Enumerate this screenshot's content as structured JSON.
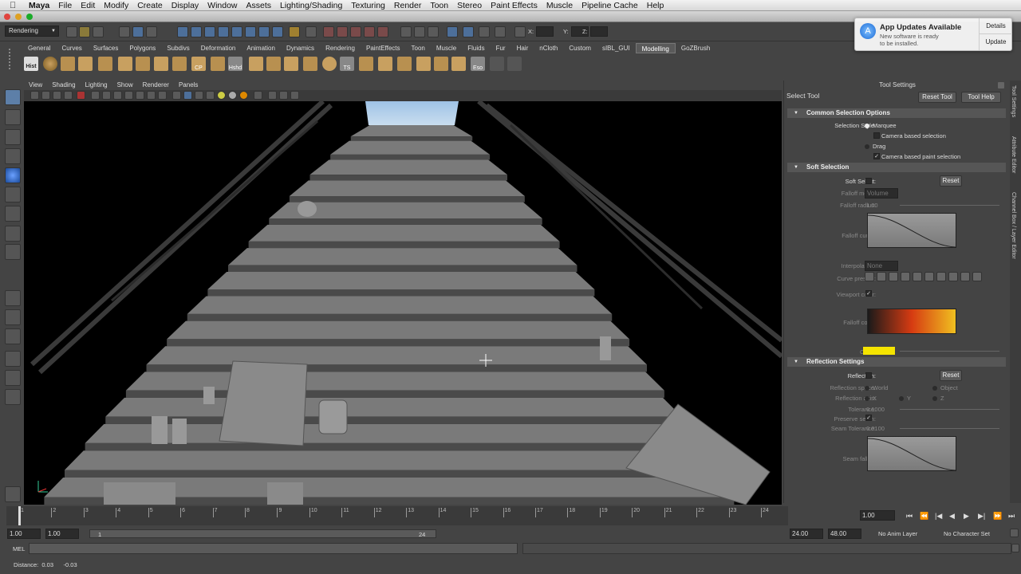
{
  "menubar": {
    "app": "Maya",
    "items": [
      "File",
      "Edit",
      "Modify",
      "Create",
      "Display",
      "Window",
      "Assets",
      "Lighting/Shading",
      "Texturing",
      "Render",
      "Toon",
      "Stereo",
      "Paint Effects",
      "Muscle",
      "Pipeline Cache",
      "Help"
    ]
  },
  "notification": {
    "title": "App Updates Available",
    "body": "New software is ready to be installed.",
    "details_label": "Details",
    "update_label": "Update"
  },
  "statusline": {
    "menuset": "Rendering",
    "x_label": "X:",
    "y_label": "Y:",
    "z_label": "Z:"
  },
  "shelf": {
    "tabs": [
      "General",
      "Curves",
      "Surfaces",
      "Polygons",
      "Subdivs",
      "Deformation",
      "Animation",
      "Dynamics",
      "Rendering",
      "PaintEffects",
      "Toon",
      "Muscle",
      "Fluids",
      "Fur",
      "Hair",
      "nCloth",
      "Custom",
      "sIBL_GUI",
      "Modelling",
      "GoZBrush"
    ],
    "active_tab": "Modelling",
    "icon_labels": {
      "hist": "Hist",
      "cp": "CP",
      "hshd": "Hshd",
      "ts": "TS",
      "eso": "Eso"
    }
  },
  "viewport_menu": [
    "View",
    "Shading",
    "Lighting",
    "Show",
    "Renderer",
    "Panels"
  ],
  "tool_settings": {
    "title": "Tool Settings",
    "tool_name": "Select Tool",
    "reset_tool": "Reset Tool",
    "tool_help": "Tool Help",
    "common": {
      "header": "Common Selection Options",
      "selection_style_label": "Selection Style:",
      "marquee": "Marquee",
      "camera_based_selection": "Camera based selection",
      "drag": "Drag",
      "camera_based_paint": "Camera based paint selection"
    },
    "soft": {
      "header": "Soft Selection",
      "soft_select_label": "Soft Select:",
      "reset": "Reset",
      "falloff_mode_label": "Falloff mode:",
      "falloff_mode_value": "Volume",
      "falloff_radius_label": "Falloff radius:",
      "falloff_radius_value": "1.00",
      "falloff_curve_label": "Falloff curve:",
      "interpolation_label": "Interpolation:",
      "interpolation_value": "None",
      "curve_presets_label": "Curve presets:",
      "viewport_color_label": "Viewport color:",
      "falloff_color_label": "Falloff color:",
      "color_label": "Color:"
    },
    "reflection": {
      "header": "Reflection Settings",
      "reflection_label": "Reflection:",
      "reset": "Reset",
      "space_label": "Reflection space:",
      "world": "World",
      "object": "Object",
      "axis_label": "Reflection axis:",
      "x": "X",
      "y": "Y",
      "z": "Z",
      "tolerance_label": "Tolerance:",
      "tolerance_value": "0.1000",
      "preserve_seam_label": "Preserve seam:",
      "seam_tolerance_label": "Seam Tolerance:",
      "seam_tolerance_value": "0.0100",
      "seam_falloff_label": "Seam falloff:"
    },
    "colors": {
      "falloff_start": "#1a1a1a",
      "falloff_mid": "#d63b12",
      "falloff_end": "#f0c020",
      "color_swatch": "#f5e400"
    }
  },
  "side_tabs": [
    "Tool Settings",
    "Attribute Editor",
    "Channel Box / Layer Editor"
  ],
  "timeslider": {
    "ticks": [
      "1",
      "2",
      "3",
      "4",
      "5",
      "6",
      "7",
      "8",
      "9",
      "10",
      "11",
      "12",
      "13",
      "14",
      "15",
      "16",
      "17",
      "18",
      "19",
      "20",
      "21",
      "22",
      "23",
      "24"
    ],
    "current_frame": "1.00"
  },
  "range": {
    "start": "1.00",
    "playback_start": "1.00",
    "range_start": "1",
    "range_end": "24",
    "playback_end": "24.00",
    "end": "48.00",
    "anim_layer": "No Anim Layer",
    "character_set": "No Character Set"
  },
  "cmdline": {
    "label": "MEL"
  },
  "helpline": {
    "text": "Distance:  0.03      -0.03"
  }
}
